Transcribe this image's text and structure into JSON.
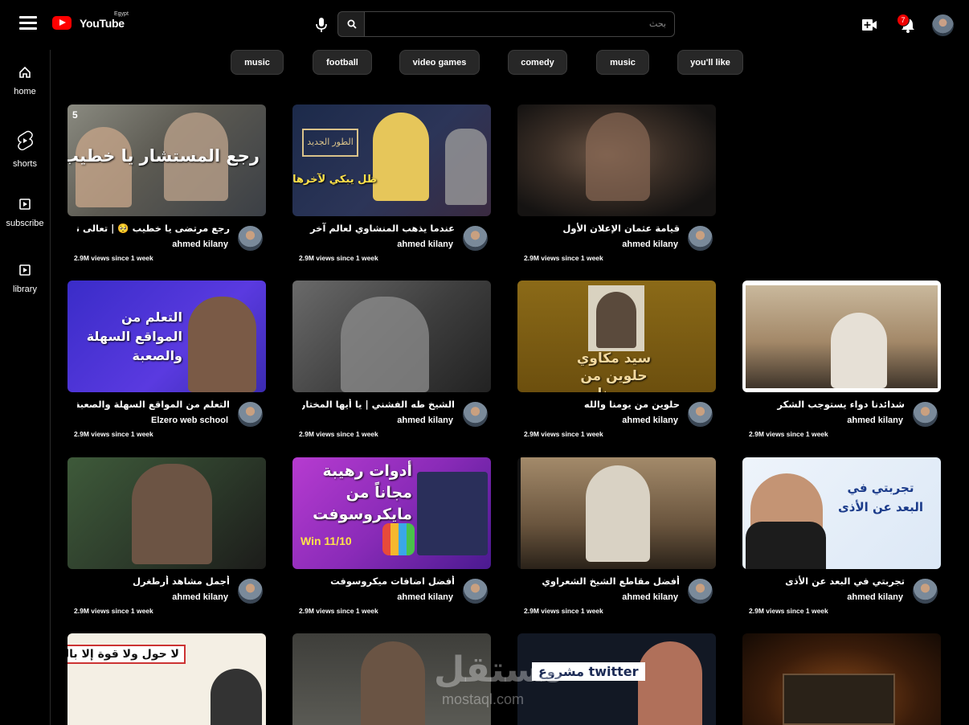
{
  "header": {
    "logo_text": "YouTube",
    "country": "Egypt",
    "search_placeholder": "بحث",
    "notifications_count": "7"
  },
  "sidebar": {
    "items": [
      {
        "label": "home",
        "icon": "home-icon"
      },
      {
        "label": "shorts",
        "icon": "shorts-icon"
      },
      {
        "label": "subscribe",
        "icon": "subscriptions-icon"
      },
      {
        "label": "library",
        "icon": "library-icon"
      }
    ]
  },
  "chips": [
    "music",
    "football",
    "video games",
    "comedy",
    "music",
    "you'll like"
  ],
  "videos": [
    {
      "title": "رجع مرتضى يا خطيب 🥺 | تعالى نتكيم",
      "channel": "ahmed kilany",
      "views": "2.9M views since 1 week",
      "thumb_text": "رجع المستشار يا خطيب"
    },
    {
      "title": "عندما يذهب المنشاوي لعالم آخر",
      "channel": "ahmed kilany",
      "views": "2.9M views since 1 week",
      "thumb_text": "ظل يبكي لآخرها"
    },
    {
      "title": "قيامة عثمان الإعلان الأول",
      "channel": "ahmed kilany",
      "views": "2.9M views since 1 week",
      "thumb_text": ""
    },
    null,
    {
      "title": "التعلم من المواقع السهلة والصعبة",
      "channel": "Elzero web school",
      "views": "2.9M views since 1 week",
      "thumb_text": "التعلم من المواقع السهلة والصعبة"
    },
    {
      "title": "الشيخ طه الفشني | يا أيها المختار",
      "channel": "ahmed kilany",
      "views": "2.9M views since 1 week",
      "thumb_text": ""
    },
    {
      "title": "حلوين من يومنا والله",
      "channel": "ahmed kilany",
      "views": "2.9M views since 1 week",
      "thumb_text": "سيد مكاوي حلوين من يومنا"
    },
    {
      "title": "شدائدنا دواء يستوجب الشكر",
      "channel": "ahmed kilany",
      "views": "2.9M views since 1 week",
      "thumb_text": ""
    },
    {
      "title": "أجمل مشاهد أرطغرل",
      "channel": "ahmed kilany",
      "views": "2.9M views since 1 week",
      "thumb_text": ""
    },
    {
      "title": "أفضل اضافات ميكروسوفت",
      "channel": "ahmed kilany",
      "views": "2.9M views since 1 week",
      "thumb_text": "أدوات رهيبة مجاناً من مايكروسوفت"
    },
    {
      "title": "أفضل مقاطع الشيخ الشعراوي",
      "channel": "ahmed kilany",
      "views": "2.9M views since 1 week",
      "thumb_text": ""
    },
    {
      "title": "تجربتي في البعد عن الأذى",
      "channel": "ahmed kilany",
      "views": "2.9M views since 1 week",
      "thumb_text": "تجربتي في البعد عن الأذى"
    },
    {
      "title": "",
      "channel": "",
      "views": "",
      "thumb_text": "لا حول ولا قوة إلا بالله"
    },
    {
      "title": "",
      "channel": "",
      "views": "",
      "thumb_text": ""
    },
    {
      "title": "",
      "channel": "",
      "views": "",
      "thumb_text": "مشروع twitter"
    },
    {
      "title": "",
      "channel": "",
      "views": "",
      "thumb_text": ""
    }
  ],
  "watermark": {
    "arabic": "مستقل",
    "latin": "mostaql.com"
  }
}
